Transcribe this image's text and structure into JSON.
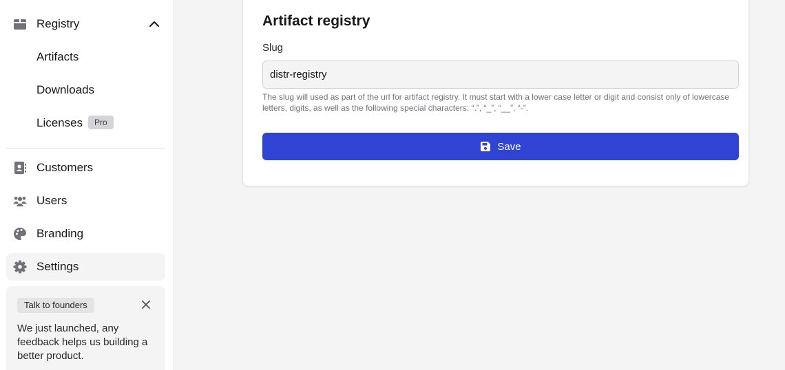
{
  "sidebar": {
    "registry": {
      "label": "Registry",
      "icon": "box-icon",
      "expanded": true
    },
    "sub_items": [
      {
        "label": "Artifacts"
      },
      {
        "label": "Downloads"
      },
      {
        "label": "Licenses",
        "badge": "Pro"
      }
    ],
    "items": [
      {
        "label": "Customers",
        "icon": "contact-book-icon"
      },
      {
        "label": "Users",
        "icon": "users-icon"
      },
      {
        "label": "Branding",
        "icon": "palette-icon"
      },
      {
        "label": "Settings",
        "icon": "gear-icon",
        "active": true
      }
    ],
    "promo": {
      "tag": "Talk to founders",
      "text": "We just launched, any feedback helps us building a better product."
    }
  },
  "main": {
    "title": "Artifact registry",
    "slug_label": "Slug",
    "slug_value": "distr-registry",
    "help_text": "The slug will used as part of the url for artifact registry. It must start with a lower case letter or digit and consist only of lowercase letters, digits, as well as the following special characters: “.”, “_”, “__”, “-”.",
    "save_label": "Save"
  },
  "colors": {
    "accent": "#2f44d2",
    "icon": "#71717a",
    "active_bg": "#f4f4f5"
  }
}
